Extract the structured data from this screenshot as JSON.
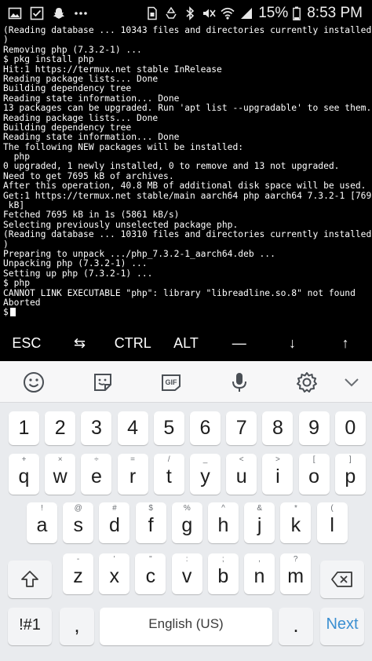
{
  "status_bar": {
    "left_icons": [
      "image-icon",
      "checkbox-icon",
      "snapchat-icon",
      "more-icon"
    ],
    "right_icons": [
      "sim-icon",
      "recycle-icon",
      "bluetooth-icon",
      "mute-icon",
      "wifi-icon",
      "signal-icon"
    ],
    "battery": "15%",
    "time": "8:53 PM"
  },
  "terminal": {
    "lines": [
      "(Reading database ... 10343 files and directories currently installed.",
      ")",
      "Removing php (7.3.2-1) ...",
      "$ pkg install php",
      "Hit:1 https://termux.net stable InRelease",
      "Reading package lists... Done",
      "Building dependency tree",
      "Reading state information... Done",
      "13 packages can be upgraded. Run 'apt list --upgradable' to see them.",
      "Reading package lists... Done",
      "Building dependency tree",
      "Reading state information... Done",
      "The following NEW packages will be installed:",
      "  php",
      "0 upgraded, 1 newly installed, 0 to remove and 13 not upgraded.",
      "Need to get 7695 kB of archives.",
      "After this operation, 40.8 MB of additional disk space will be used.",
      "Get:1 https://termux.net stable/main aarch64 php aarch64 7.3.2-1 [7695",
      " kB]",
      "Fetched 7695 kB in 1s (5861 kB/s)",
      "Selecting previously unselected package php.",
      "(Reading database ... 10310 files and directories currently installed.",
      ")",
      "Preparing to unpack .../php_7.3.2-1_aarch64.deb ...",
      "Unpacking php (7.3.2-1) ...",
      "Setting up php (7.3.2-1) ...",
      "$ php",
      "CANNOT LINK EXECUTABLE \"php\": library \"libreadline.so.8\" not found",
      "Aborted"
    ],
    "prompt": "$ "
  },
  "extra_keys": [
    "ESC",
    "⇆",
    "CTRL",
    "ALT",
    "—",
    "↓",
    "↑"
  ],
  "keyboard": {
    "toolbar_icons": [
      "emoji-icon",
      "sticker-icon",
      "gif-icon",
      "microphone-icon",
      "settings-icon",
      "collapse-icon"
    ],
    "gif_label": "GIF",
    "number_row": [
      "1",
      "2",
      "3",
      "4",
      "5",
      "6",
      "7",
      "8",
      "9",
      "0"
    ],
    "row1": [
      {
        "k": "q",
        "h": "+"
      },
      {
        "k": "w",
        "h": "×"
      },
      {
        "k": "e",
        "h": "÷"
      },
      {
        "k": "r",
        "h": "="
      },
      {
        "k": "t",
        "h": "/"
      },
      {
        "k": "y",
        "h": "_"
      },
      {
        "k": "u",
        "h": "<"
      },
      {
        "k": "i",
        "h": ">"
      },
      {
        "k": "o",
        "h": "["
      },
      {
        "k": "p",
        "h": "]"
      }
    ],
    "row2": [
      {
        "k": "a",
        "h": "!"
      },
      {
        "k": "s",
        "h": "@"
      },
      {
        "k": "d",
        "h": "#"
      },
      {
        "k": "f",
        "h": "$"
      },
      {
        "k": "g",
        "h": "%"
      },
      {
        "k": "h",
        "h": "^"
      },
      {
        "k": "j",
        "h": "&"
      },
      {
        "k": "k",
        "h": "*"
      },
      {
        "k": "l",
        "h": "("
      }
    ],
    "row3": [
      {
        "k": "z",
        "h": "-"
      },
      {
        "k": "x",
        "h": "'"
      },
      {
        "k": "c",
        "h": "\""
      },
      {
        "k": "v",
        "h": ":"
      },
      {
        "k": "b",
        "h": ";"
      },
      {
        "k": "n",
        "h": ","
      },
      {
        "k": "m",
        "h": "?"
      }
    ],
    "symbols_label": "!#1",
    "comma_label": ",",
    "space_label": "English (US)",
    "period_label": ".",
    "next_label": "Next"
  }
}
